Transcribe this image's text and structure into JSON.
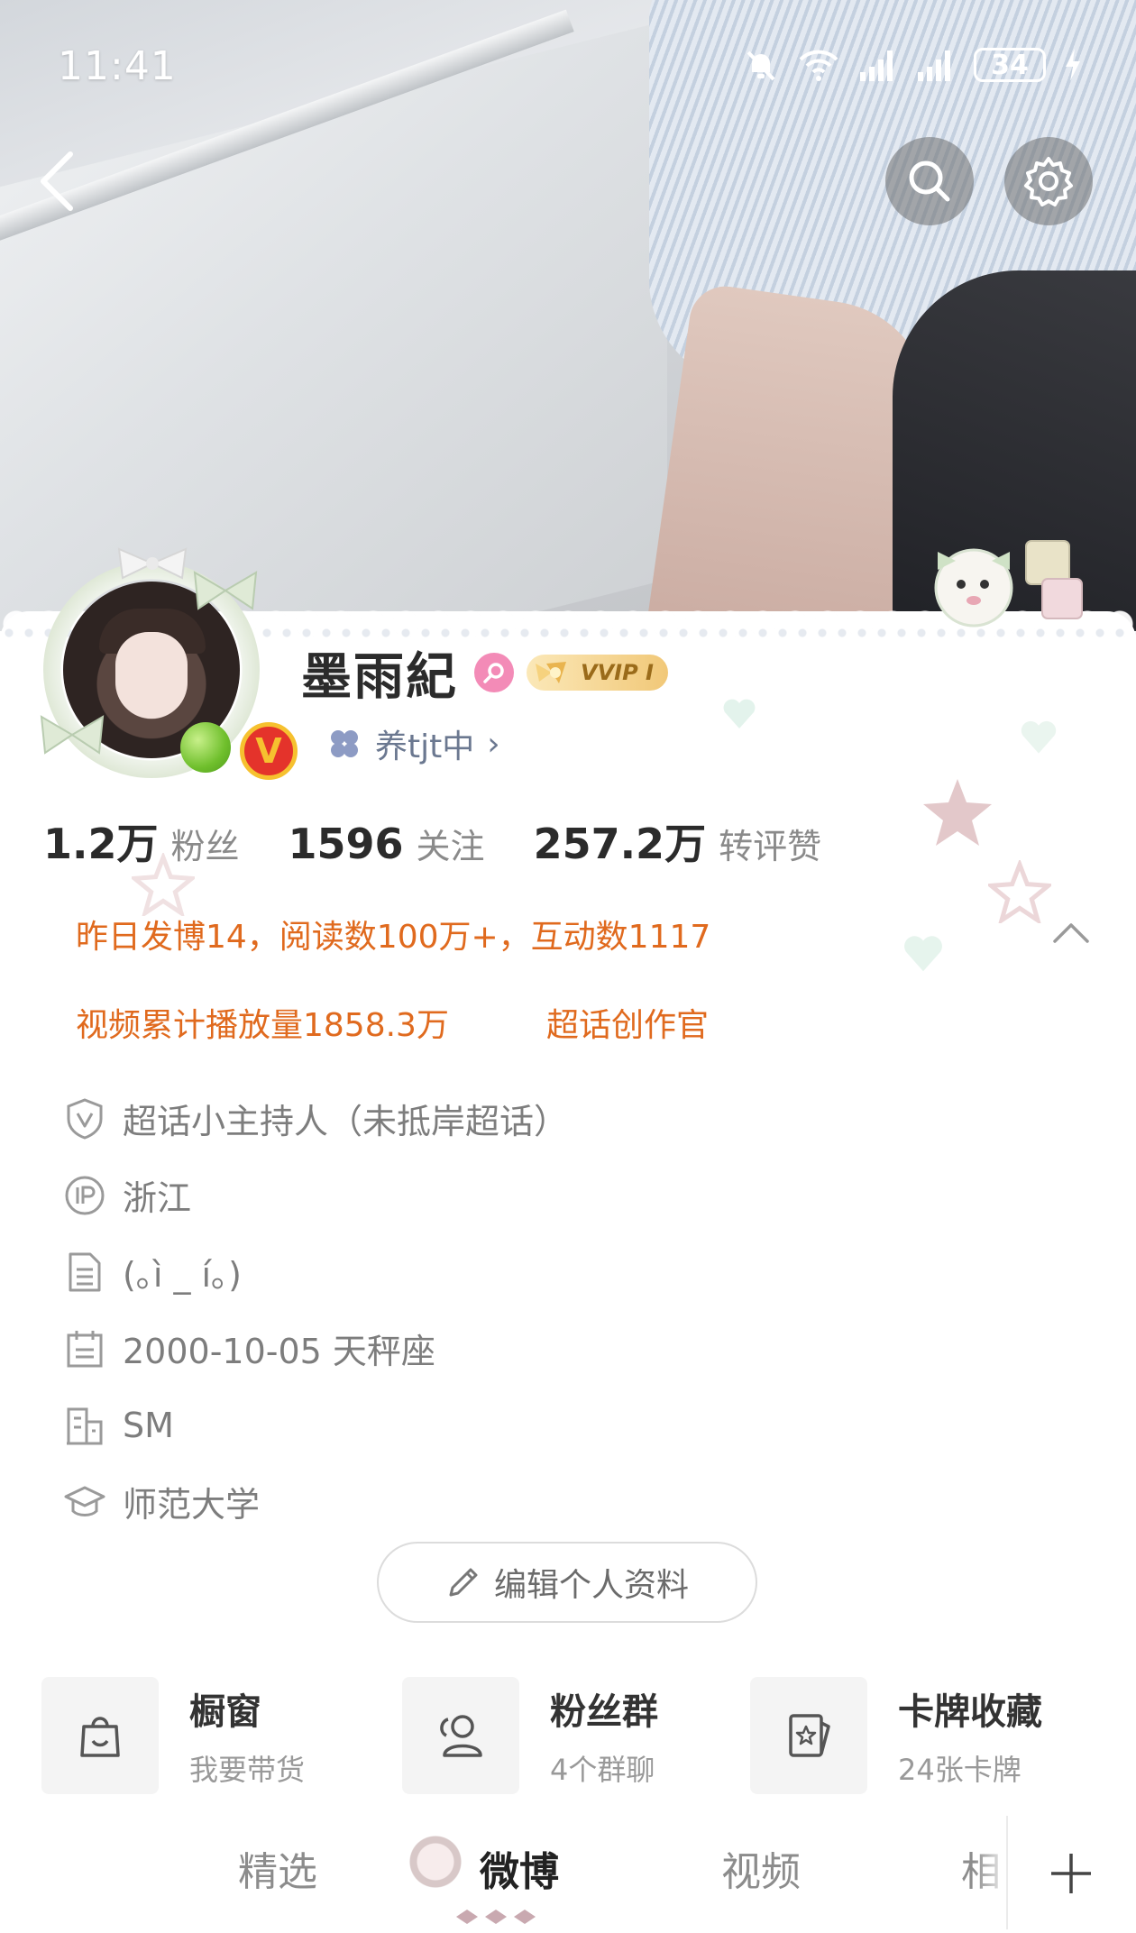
{
  "status_bar": {
    "time": "11:41",
    "battery": "34"
  },
  "profile": {
    "name": "墨雨紀",
    "vip_label": "VVIP I",
    "subtitle": "养tjt中",
    "subtitle_chevron": "›",
    "verified_mark": "V"
  },
  "stats": [
    {
      "value": "1.2万",
      "label": "粉丝"
    },
    {
      "value": "1596",
      "label": "关注"
    },
    {
      "value": "257.2万",
      "label": "转评赞"
    }
  ],
  "highlights": {
    "line1": "昨日发博14，阅读数100万+，互动数1117",
    "video_plays": "视频累计播放量1858.3万",
    "badge": "超话创作官"
  },
  "info": [
    {
      "icon": "shield-v-icon",
      "text": "超话小主持人（未抵岸超话）"
    },
    {
      "icon": "ip-icon",
      "text": "浙江"
    },
    {
      "icon": "document-icon",
      "text": "(｡ì _ í｡)"
    },
    {
      "icon": "calendar-icon",
      "text": "2000-10-05 天秤座"
    },
    {
      "icon": "building-icon",
      "text": "SM"
    },
    {
      "icon": "graduation-cap-icon",
      "text": "师范大学"
    }
  ],
  "edit_button": "编辑个人资料",
  "features": [
    {
      "icon": "shopping-bag-icon",
      "title": "橱窗",
      "sub": "我要带货"
    },
    {
      "icon": "fan-group-icon",
      "title": "粉丝群",
      "sub": "4个群聊"
    },
    {
      "icon": "card-star-icon",
      "title": "卡牌收藏",
      "sub": "24张卡牌"
    }
  ],
  "tabs": [
    "精选",
    "微博",
    "视频",
    "相"
  ],
  "active_tab": "微博",
  "colors": {
    "accent_orange": "#e06a1e",
    "vip_gold": "#f1c878",
    "verified_red": "#e4332b",
    "gender_pink": "#f38bb7"
  }
}
